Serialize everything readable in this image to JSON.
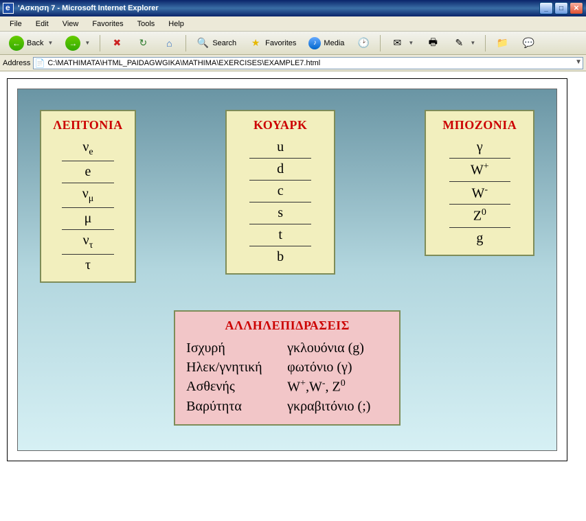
{
  "window": {
    "title": "'Aσκηση 7 - Microsoft Internet Explorer"
  },
  "menu": {
    "file": "File",
    "edit": "Edit",
    "view": "View",
    "favorites": "Favorites",
    "tools": "Tools",
    "help": "Help"
  },
  "toolbar": {
    "back": "Back",
    "search": "Search",
    "favorites": "Favorites",
    "media": "Media"
  },
  "address": {
    "label": "Address",
    "value": "C:\\MATHIMATA\\HTML_PAIDAGWGIKA\\MATHIMA\\EXERCISES\\EXAMPLE7.html"
  },
  "cards": {
    "leptons": {
      "title": "ΛΕΠΤΟΝΙΑ",
      "items": [
        "ν<sub>e</sub>",
        "e",
        "ν<sub>μ</sub>",
        "μ",
        "ν<sub>τ</sub>",
        "τ"
      ]
    },
    "quarks": {
      "title": "ΚΟΥΑΡΚ",
      "items": [
        "u",
        "d",
        "c",
        "s",
        "t",
        "b"
      ]
    },
    "bosons": {
      "title": "ΜΠΟΖΟΝΙΑ",
      "items": [
        "γ",
        "W<sup>+</sup>",
        "W<sup>-</sup>",
        "Z<sup>0</sup>",
        "g"
      ]
    }
  },
  "interactions": {
    "title": "ΑΛΛΗΛΕΠΙΔΡΑΣΕΙΣ",
    "rows": [
      {
        "force": "Ισχυρή",
        "carrier": "γκλουόνια (g)"
      },
      {
        "force": "Ηλεκ/γνητική",
        "carrier": "φωτόνιο (γ)"
      },
      {
        "force": "Ασθενής",
        "carrier": "W<sup>+</sup>,W<sup>-</sup>, Z<sup>0</sup>"
      },
      {
        "force": "Βαρύτητα",
        "carrier": "γκραβιτόνιο (;)"
      }
    ]
  }
}
